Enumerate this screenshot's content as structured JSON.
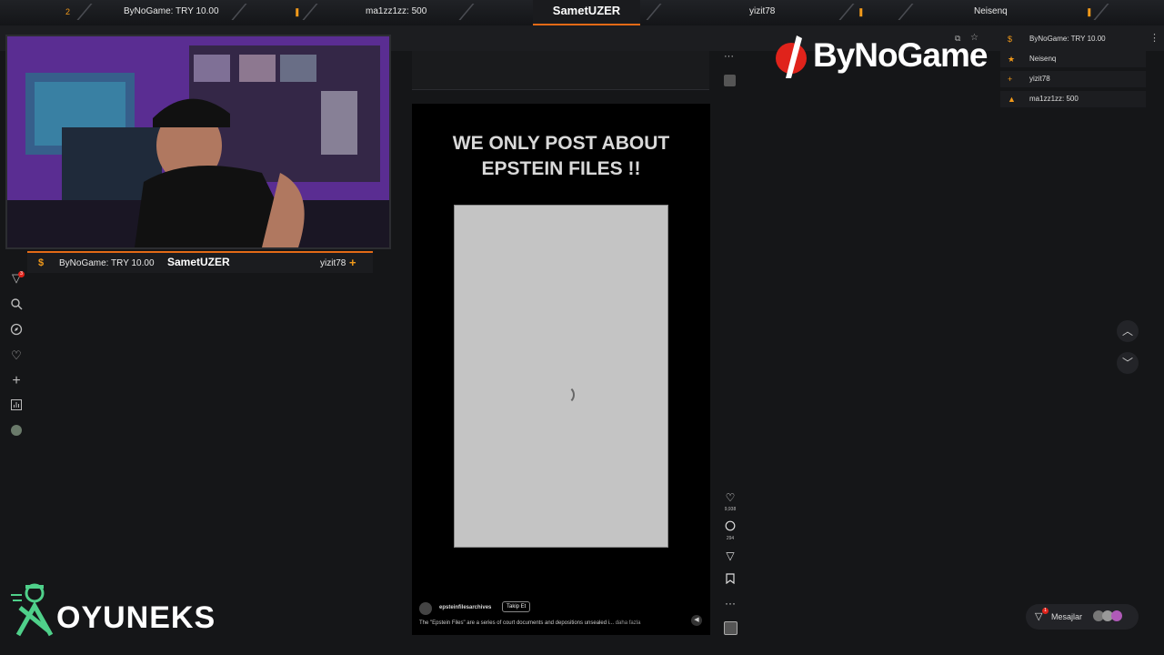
{
  "topbar": {
    "left_donor": "ByNoGame: TRY 10.00",
    "mid_donor": "ma1zz1zz: 500",
    "streamer": "SametUZER",
    "right_user": "yizit78",
    "far_right_user": "Neisenq",
    "rank_left": "2"
  },
  "webcam": {
    "donor": "ByNoGame: TRY 10.00",
    "streamer": "SametUZER",
    "follower": "yizit78"
  },
  "sidebar": {
    "icons": [
      "filter-icon",
      "search-icon",
      "compass-icon",
      "heart-icon",
      "plus-icon",
      "chart-icon",
      "avatar-icon"
    ],
    "badge": "3"
  },
  "post": {
    "headline_line1": "WE ONLY POST ABOUT",
    "headline_line2": "EPSTEIN FILES !!",
    "username": "epsteinfilesarchives",
    "follow_label": "Takip Et",
    "caption": "The \"Epstein Files\" are a series of court documents and depositions unsealed i...",
    "more_label": "daha fazla",
    "likes": "9,938",
    "comments": "294"
  },
  "logo_text": "ByNoGame",
  "chat_list": [
    {
      "label": "ByNoGame: TRY 10.00"
    },
    {
      "label": "Neisenq"
    },
    {
      "label": "yizit78"
    },
    {
      "label": "ma1zz1zz: 500"
    }
  ],
  "messages": {
    "label": "Mesajlar",
    "badge": "1"
  },
  "brand": {
    "name": "OYUNEKS"
  },
  "colors": {
    "accent": "#e36a16",
    "bg": "#151618",
    "logo_red": "#e0231b"
  }
}
